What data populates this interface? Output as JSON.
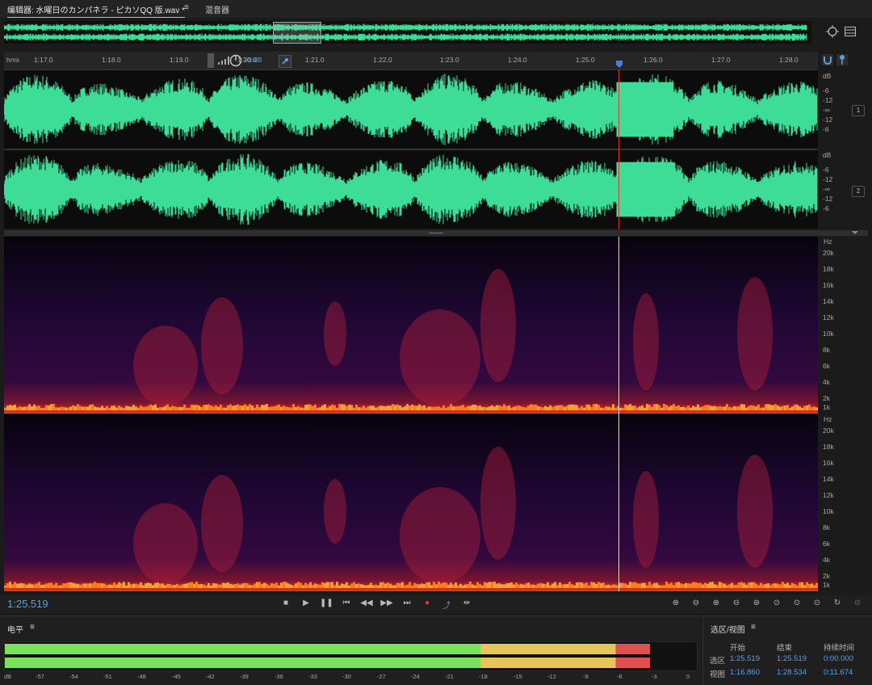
{
  "tabs": {
    "editor": "编辑器: 水曜日のカンパネラ - ピカソQQ 版.wav *",
    "menu_glyph": "≡",
    "mixer": "混音器"
  },
  "ruler": {
    "unit": "hms",
    "ticks": [
      "1:17.0",
      "1:18.0",
      "1:19.0",
      "1:20.0",
      "1:21.0",
      "1:22.0",
      "1:23.0",
      "1:24.0",
      "1:25.0",
      "1:26.0",
      "1:27.0",
      "1:28.0"
    ],
    "volume": "+0 dB"
  },
  "waveform": {
    "db_label": "dB",
    "db_ticks": [
      "-6",
      "-12",
      "-∞",
      "-12",
      "-6"
    ],
    "channels": [
      "1",
      "2"
    ]
  },
  "spectral": {
    "hz_label": "Hz",
    "hz_ticks": [
      "20k",
      "18k",
      "16k",
      "14k",
      "12k",
      "10k",
      "8k",
      "6k",
      "4k",
      "2k",
      "1k"
    ]
  },
  "transport": {
    "time": "1:25.519"
  },
  "levels": {
    "title": "电平",
    "menu_glyph": "≡",
    "scale": [
      "dB",
      "-57",
      "-54",
      "-51",
      "-48",
      "-45",
      "-42",
      "-39",
      "-36",
      "-33",
      "-30",
      "-27",
      "-24",
      "-21",
      "-18",
      "-15",
      "-12",
      "-9",
      "-6",
      "-3",
      "0"
    ],
    "level_fraction": 0.94
  },
  "selection_view": {
    "title": "选区/视图",
    "menu_glyph": "≡",
    "headers": [
      "开始",
      "结束",
      "持续时间"
    ],
    "rows": [
      {
        "label": "选区",
        "start": "1:25.519",
        "end": "1:25.519",
        "duration": "0:00.000"
      },
      {
        "label": "视图",
        "start": "1:16.860",
        "end": "1:28.534",
        "duration": "0:11.674"
      }
    ]
  },
  "colors": {
    "waveform": "#3ddc97",
    "playhead": "#d33",
    "accent": "#4a90d9",
    "meter_green": "#79e25a",
    "meter_yellow": "#e6c55a",
    "meter_red": "#e05050"
  }
}
